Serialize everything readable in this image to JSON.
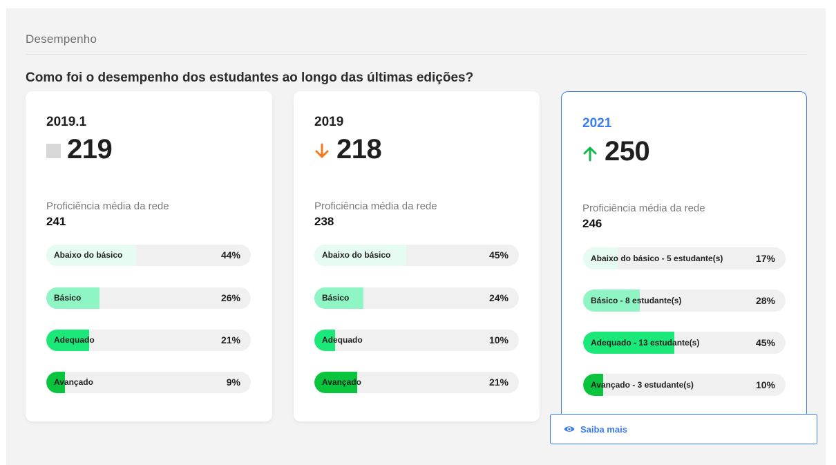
{
  "section": {
    "title": "Desempenho"
  },
  "question": "Como foi o desempenho dos estudantes ao longo das últimas edições?",
  "cards": [
    {
      "year": "2019.1",
      "score": "219",
      "trend": "neutral",
      "proficiency_label": "Proficiência média da rede",
      "proficiency_value": "241",
      "levels": [
        {
          "label": "Abaixo do básico",
          "percent": "44%",
          "fill": 0.44,
          "color": "#e6fbf1"
        },
        {
          "label": "Básico",
          "percent": "26%",
          "fill": 0.26,
          "color": "#8ff5c4"
        },
        {
          "label": "Adequado",
          "percent": "21%",
          "fill": 0.21,
          "color": "#1ce879"
        },
        {
          "label": "Avançado",
          "percent": "9%",
          "fill": 0.09,
          "color": "#0bc43d"
        }
      ]
    },
    {
      "year": "2019",
      "score": "218",
      "trend": "down",
      "trend_color": "#f47a1f",
      "proficiency_label": "Proficiência média da rede",
      "proficiency_value": "238",
      "levels": [
        {
          "label": "Abaixo do básico",
          "percent": "45%",
          "fill": 0.45,
          "color": "#e6fbf1"
        },
        {
          "label": "Básico",
          "percent": "24%",
          "fill": 0.24,
          "color": "#8ff5c4"
        },
        {
          "label": "Adequado",
          "percent": "10%",
          "fill": 0.1,
          "color": "#1ce879"
        },
        {
          "label": "Avançado",
          "percent": "21%",
          "fill": 0.21,
          "color": "#0bc43d"
        }
      ]
    },
    {
      "year": "2021",
      "score": "250",
      "trend": "up",
      "trend_color": "#12b84a",
      "proficiency_label": "Proficiência média da rede",
      "proficiency_value": "246",
      "levels": [
        {
          "label": "Abaixo do básico - 5 estudante(s)",
          "percent": "17%",
          "fill": 0.17,
          "color": "#e6fbf1"
        },
        {
          "label": "Básico - 8 estudante(s)",
          "percent": "28%",
          "fill": 0.28,
          "color": "#8ff5c4"
        },
        {
          "label": "Adequado - 13 estudante(s)",
          "percent": "45%",
          "fill": 0.45,
          "color": "#1ce879"
        },
        {
          "label": "Avançado - 3 estudante(s)",
          "percent": "10%",
          "fill": 0.1,
          "color": "#0bc43d"
        }
      ]
    }
  ],
  "saiba_mais": {
    "label": "Saiba mais",
    "icon": "eye-icon"
  },
  "colors": {
    "accent": "#3b7cf0"
  }
}
